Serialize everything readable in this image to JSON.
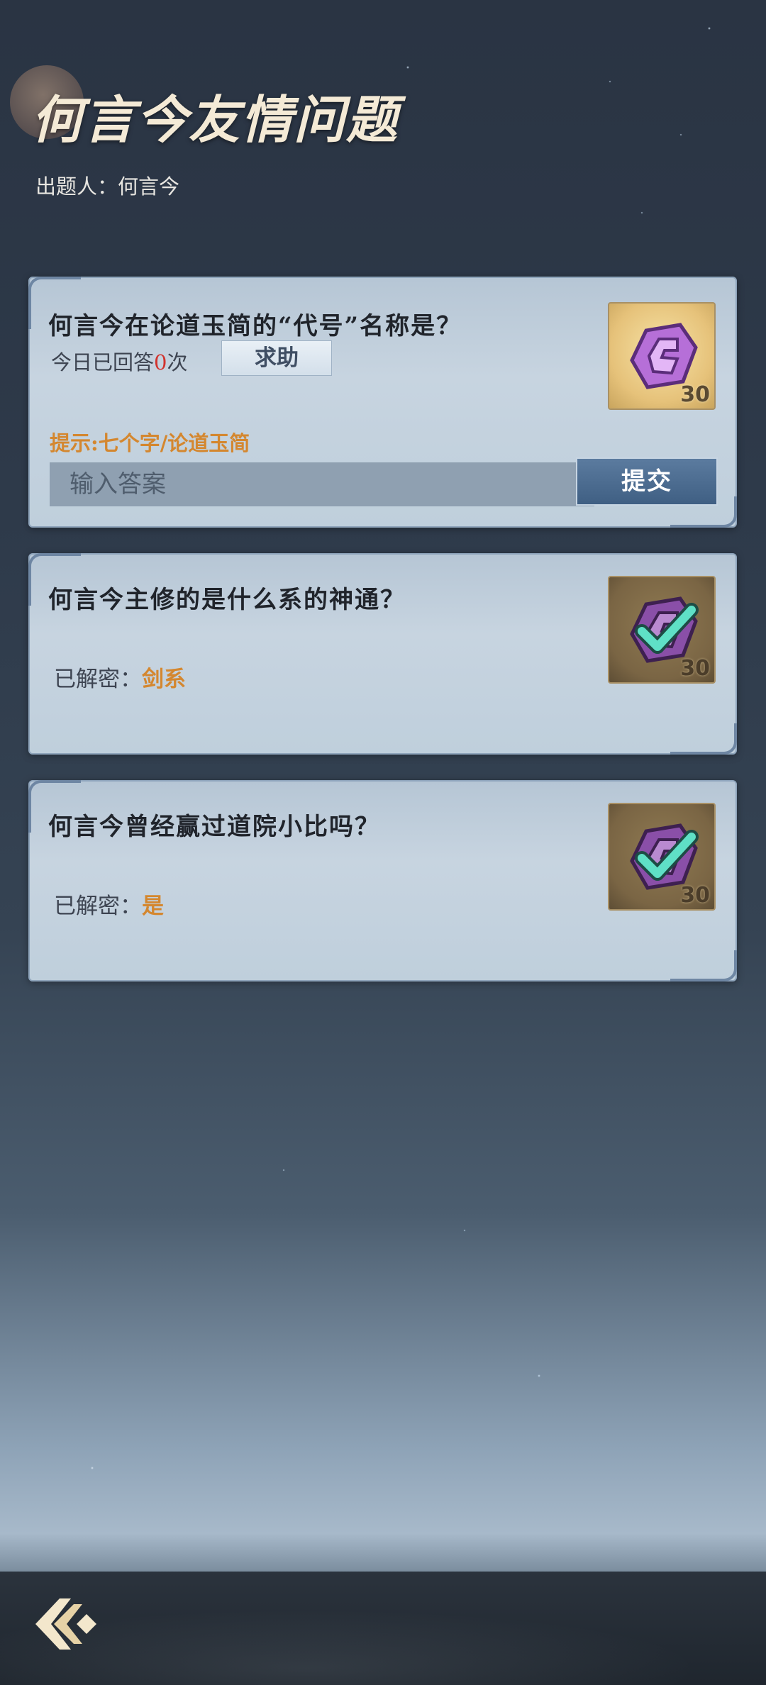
{
  "header": {
    "title": "何言今友情问题",
    "author_label": "出题人：何言今"
  },
  "questions": [
    {
      "text": "何言今在论道玉简的“代号”名称是？",
      "count_prefix": "今日已回答",
      "count_value": "0",
      "count_suffix": "次",
      "help_label": "求助",
      "hint": "提示:七个字/论道玉简",
      "input_placeholder": "输入答案",
      "submit_label": "提交",
      "reward_qty": "30",
      "reward_icon": "purple-token-icon"
    },
    {
      "text": "何言今主修的是什么系的神通？",
      "solved_label": "已解密：",
      "solved_answer": "剑系",
      "reward_qty": "30",
      "reward_icon": "purple-token-checked-icon"
    },
    {
      "text": "何言今曾经赢过道院小比吗？",
      "solved_label": "已解密：",
      "solved_answer": "是",
      "reward_qty": "30",
      "reward_icon": "purple-token-checked-icon"
    }
  ],
  "nav": {
    "back_icon": "back-arrow-icon"
  },
  "colors": {
    "accent_orange": "#d4872f",
    "count_red": "#d2322d",
    "submit_blue": "#4a6a8f",
    "check_teal": "#5fe0c6"
  }
}
